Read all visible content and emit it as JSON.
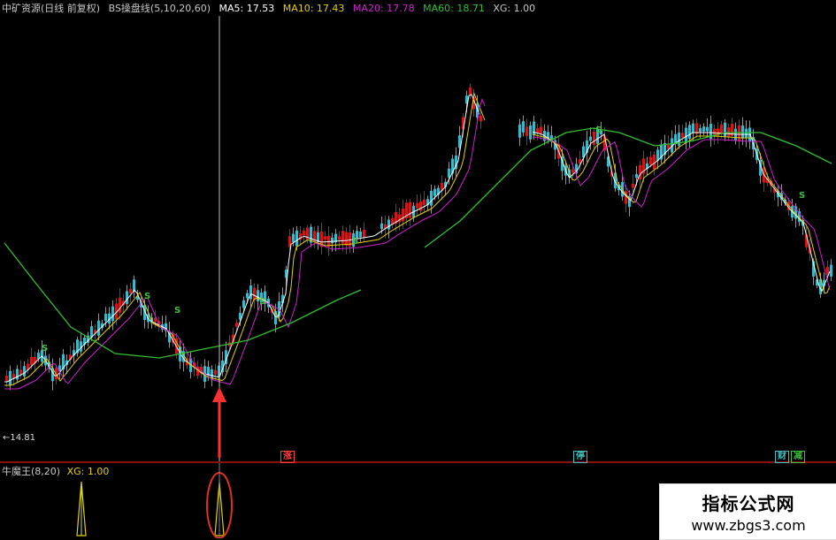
{
  "header": {
    "stock_name": "中矿资源(日线 前复权)",
    "indicator": "BS操盘线(5,10,20,60)",
    "ma5_label": "MA5: 17.53",
    "ma10_label": "MA10: 17.43",
    "ma20_label": "MA20: 17.78",
    "ma60_label": "MA60: 18.71",
    "xg_label": "XG: 1.00"
  },
  "colors": {
    "ma5": "#ffffff",
    "ma10": "#e8d000",
    "ma20": "#d020d0",
    "ma60": "#30c030",
    "up": "#d01818",
    "down": "#38b8c8",
    "signal": "#40c040"
  },
  "price_low_label": "←14.81",
  "signal_text": "S",
  "bottom_markers": [
    {
      "text": "涨",
      "color": "#ff4040"
    },
    {
      "text": "停",
      "color": "#40c0c0"
    },
    {
      "text": "财",
      "color": "#40c0c0"
    },
    {
      "text": "减",
      "color": "#40c040"
    }
  ],
  "sub_panel": {
    "title": "牛魔王(8,20)",
    "xg": "XG: 1.00"
  },
  "watermark": {
    "title": "指标公式网",
    "url": "www.zbgs3.com"
  },
  "icons": [
    "up-arrow-icon",
    "highlight-ellipse-icon"
  ]
}
